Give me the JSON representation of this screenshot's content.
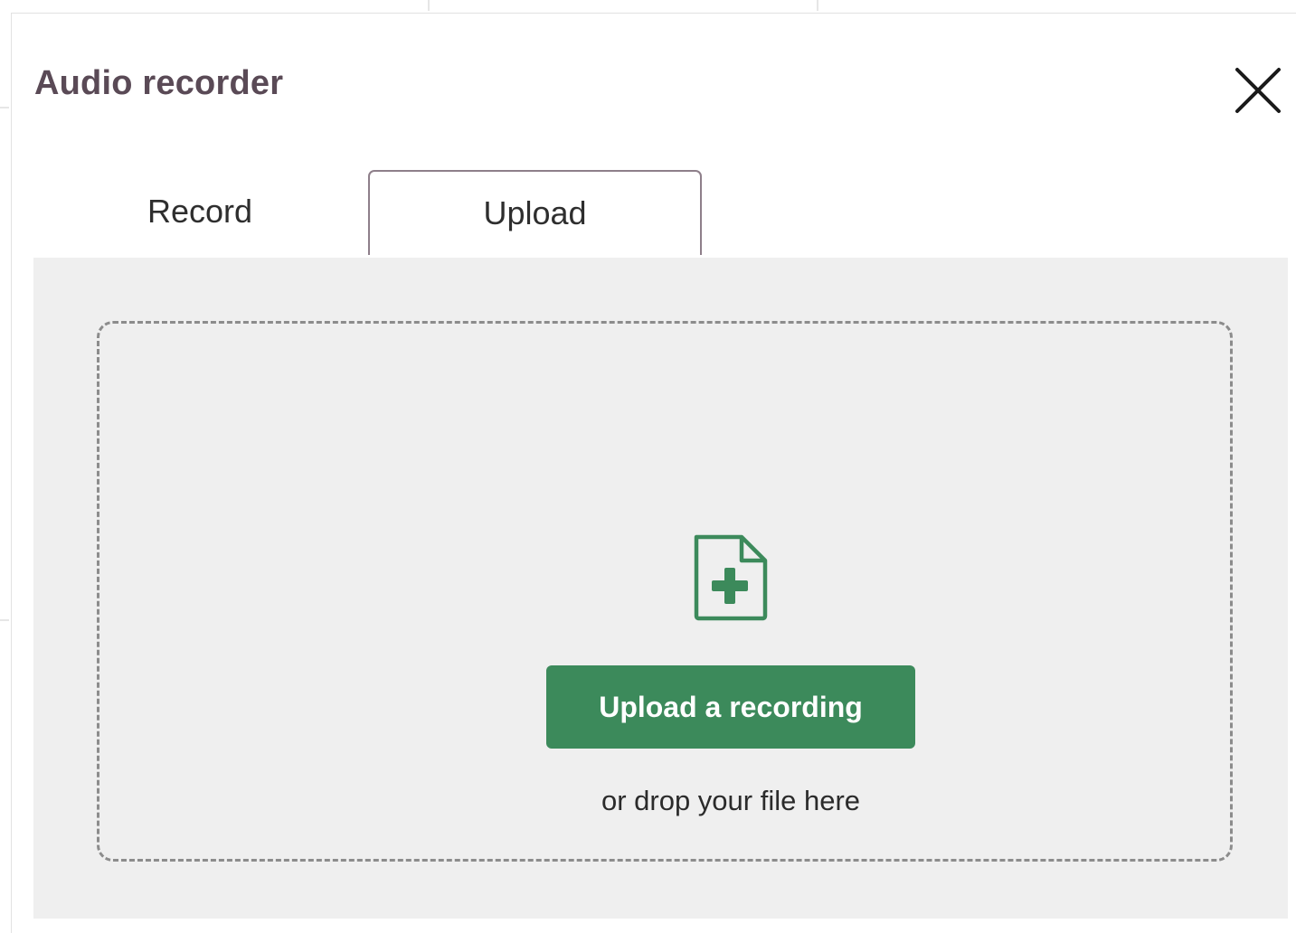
{
  "dialog": {
    "title": "Audio recorder",
    "close_icon": "close-icon"
  },
  "tabs": [
    {
      "label": "Record",
      "active": false
    },
    {
      "label": "Upload",
      "active": true
    }
  ],
  "upload": {
    "icon": "file-plus-icon",
    "button_label": "Upload a recording",
    "hint": "or drop your file here"
  },
  "colors": {
    "accent": "#3c8a5b",
    "title": "#5a4a56",
    "panel_bg": "#efefef",
    "active_tab_border": "#8e7f8a"
  }
}
